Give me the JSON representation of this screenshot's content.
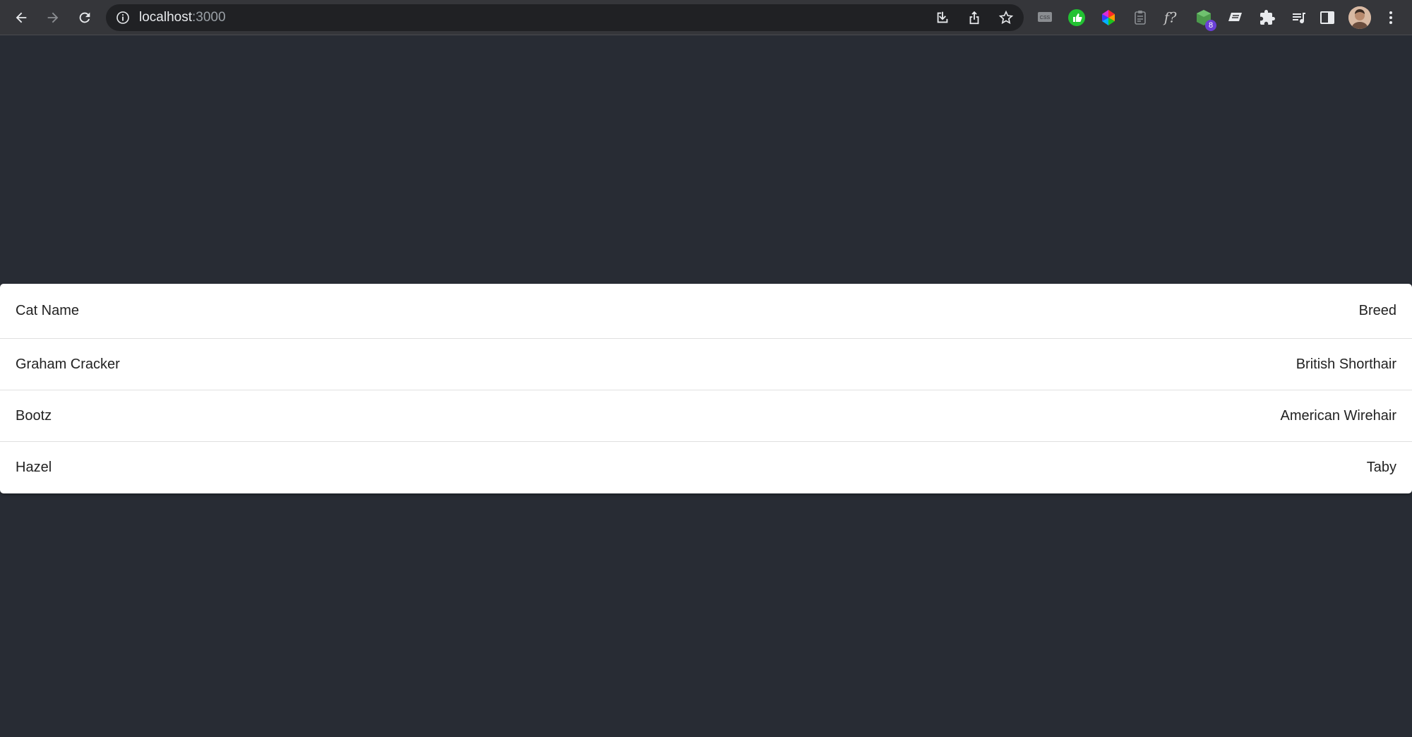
{
  "browser": {
    "url_host": "localhost",
    "url_port": ":3000",
    "extension_badge": "8",
    "extensions": [
      "css-viewer-icon",
      "thumbs-up-icon",
      "color-wheel-icon",
      "clipboard-icon",
      "font-question-icon",
      "cube-icon",
      "eraser-icon",
      "puzzle-icon",
      "playlist-icon",
      "side-panel-icon"
    ]
  },
  "table": {
    "headers": [
      "Cat Name",
      "Breed"
    ],
    "rows": [
      [
        "Graham Cracker",
        "British Shorthair"
      ],
      [
        "Bootz",
        "American Wirehair"
      ],
      [
        "Hazel",
        "Taby"
      ]
    ]
  },
  "colors": {
    "page_background": "#282c34",
    "toolbar_background": "#35363a",
    "table_background": "#ffffff"
  }
}
